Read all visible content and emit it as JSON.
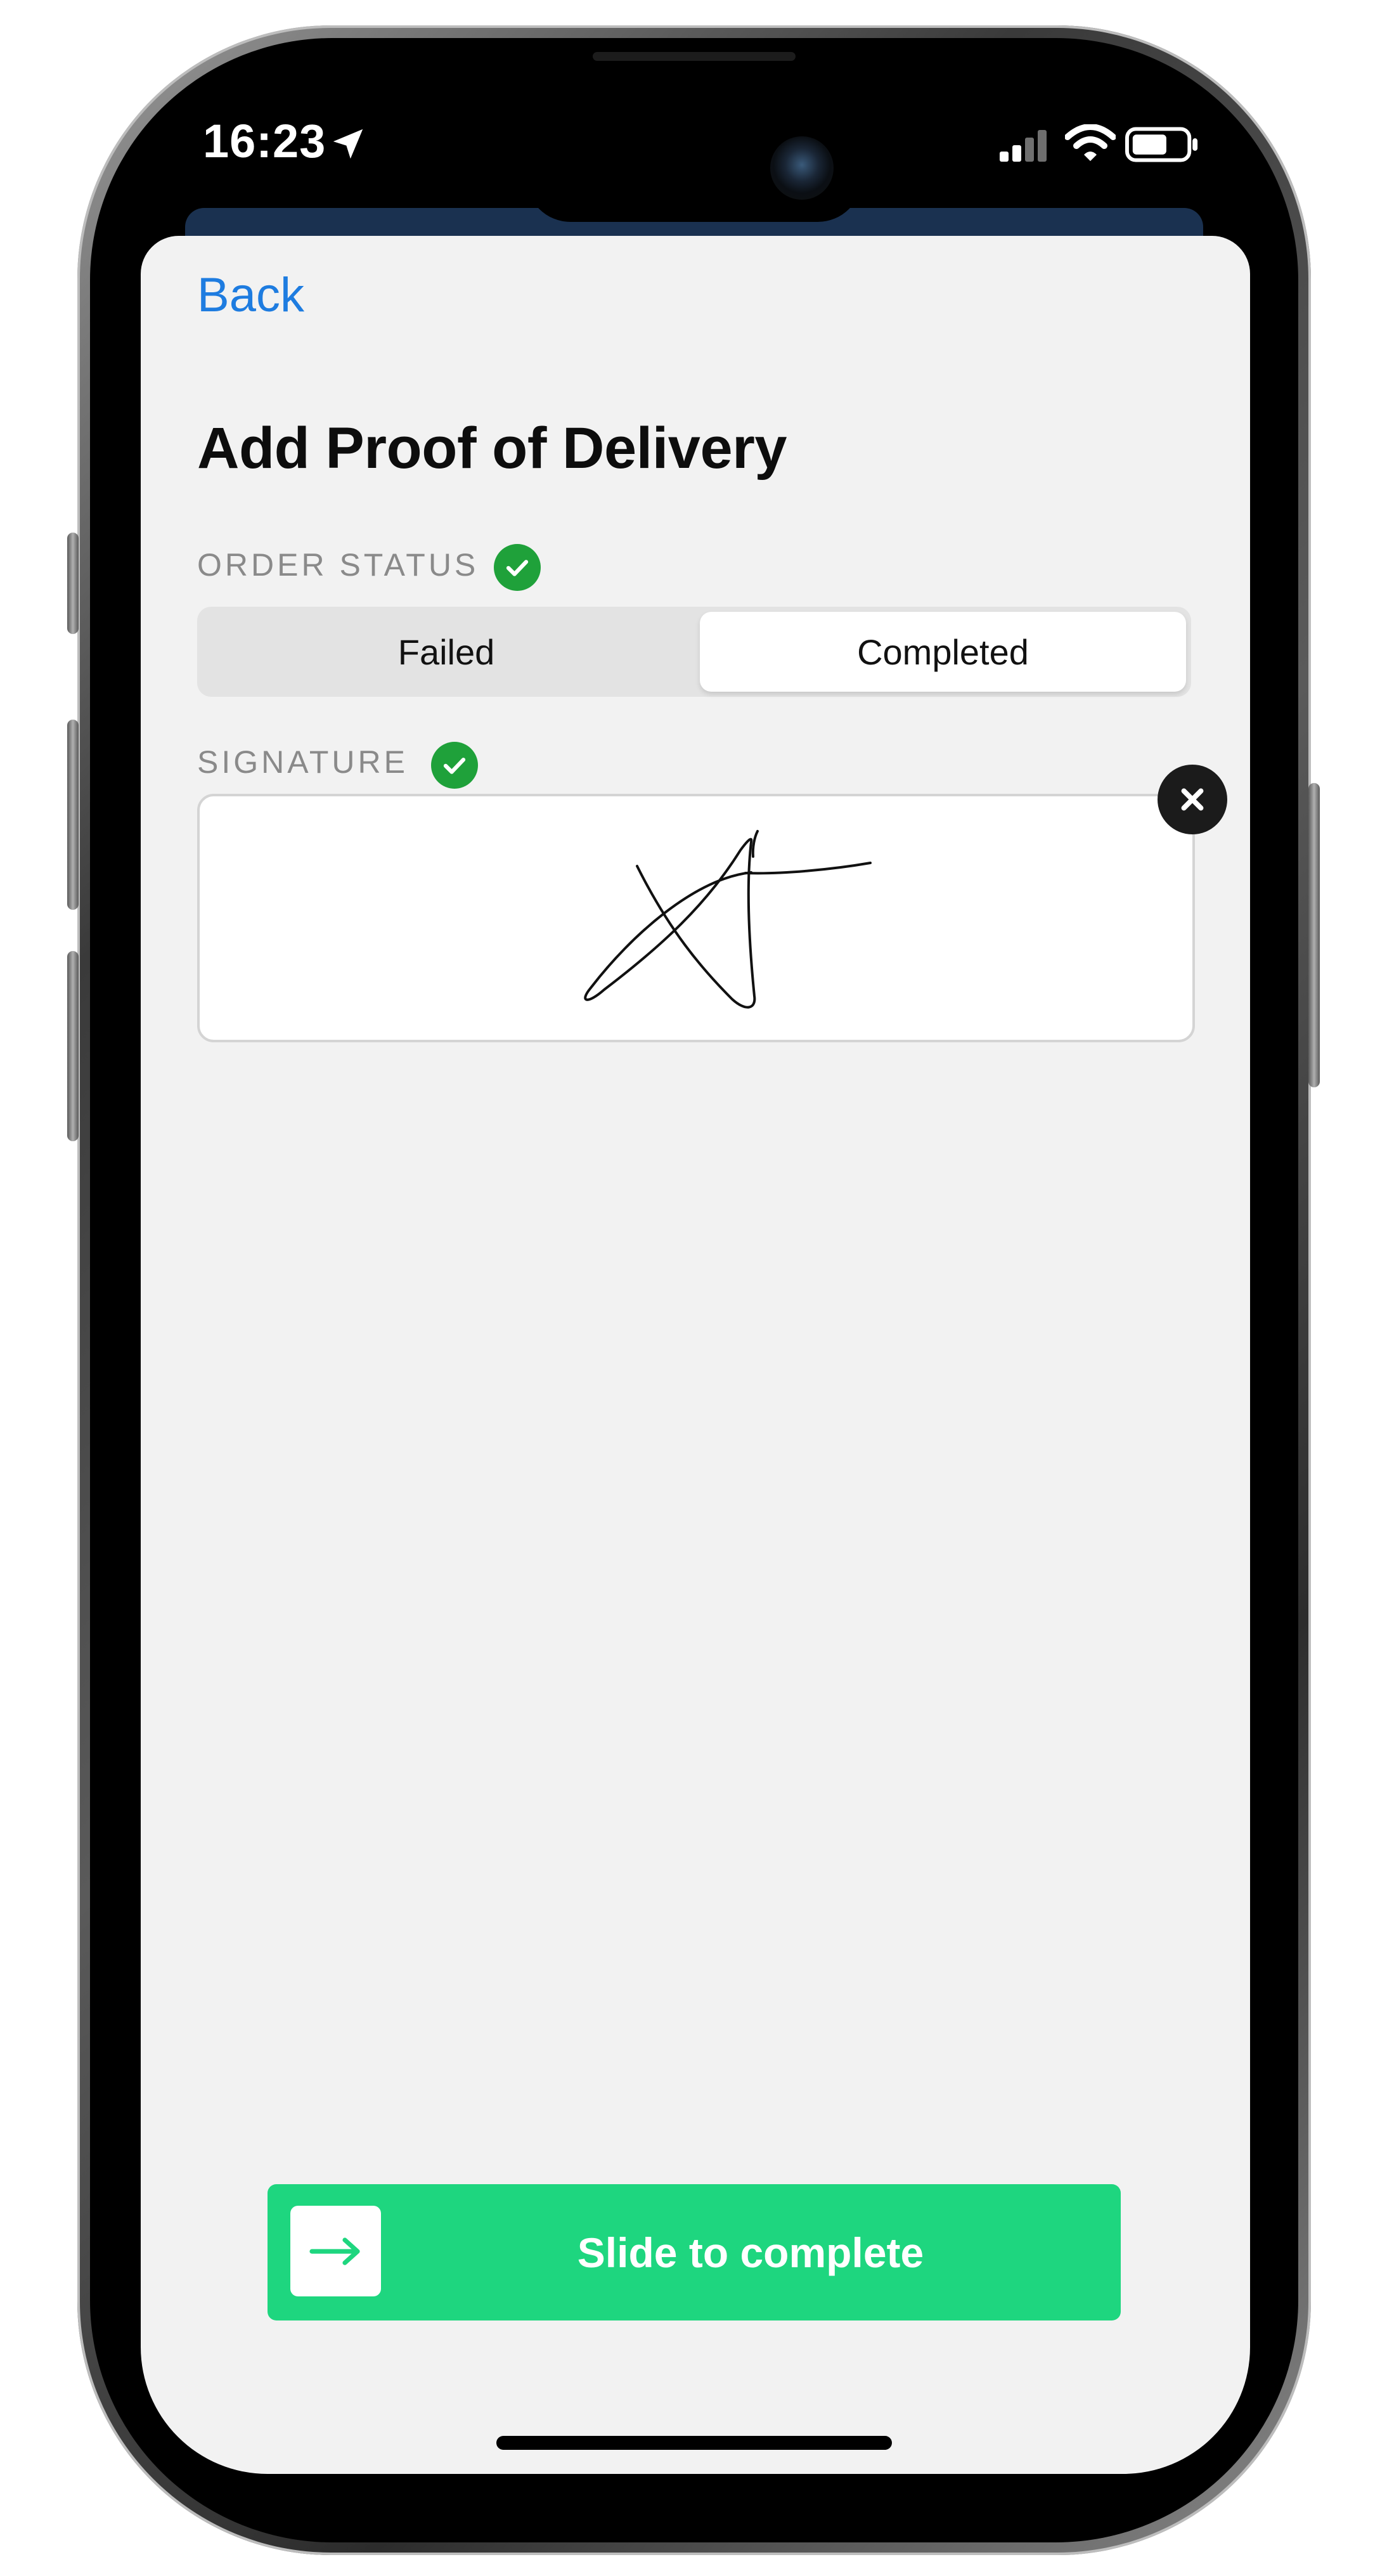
{
  "status_bar": {
    "time": "16:23",
    "icons": [
      "location-arrow-icon",
      "cellular-signal-icon",
      "wifi-icon",
      "battery-icon"
    ]
  },
  "nav": {
    "back_label": "Back"
  },
  "page": {
    "title": "Add Proof of Delivery"
  },
  "order_status": {
    "label": "ORDER STATUS",
    "options": [
      "Failed",
      "Completed"
    ],
    "selected": "Completed"
  },
  "signature": {
    "label": "SIGNATURE"
  },
  "slider": {
    "label": "Slide to complete"
  },
  "colors": {
    "accent_blue": "#1e7ce0",
    "check_green": "#1fa13a",
    "slider_green": "#1ed67f",
    "sheet_background": "#f2f2f2"
  }
}
